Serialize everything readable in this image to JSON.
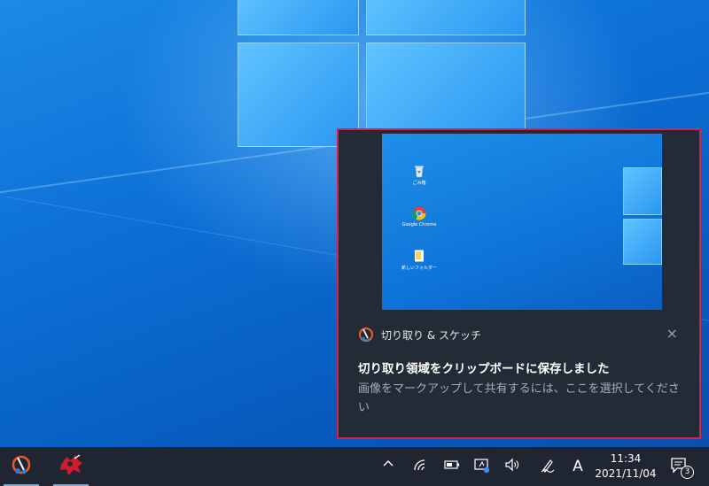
{
  "desktop": {
    "wallpaper": "Windows 10 default"
  },
  "toast": {
    "app_name": "切り取り & スケッチ",
    "close_glyph": "×",
    "title": "切り取り領域をクリップボードに保存しました",
    "body": "画像をマークアップして共有するには、ここを選択してください",
    "preview": {
      "icons": [
        {
          "name": "recycle-bin",
          "label": "ごみ箱"
        },
        {
          "name": "google-chrome",
          "label": "Google Chrome"
        },
        {
          "name": "folder-shortcut",
          "label": "新しいフォルダー"
        }
      ]
    },
    "border_color": "#d4234e"
  },
  "taskbar": {
    "apps": [
      {
        "name": "snip-and-sketch",
        "active": true
      },
      {
        "name": "paint-app",
        "active": true
      }
    ],
    "tray": {
      "chevron": "^",
      "ime_mode": "A",
      "time": "11:34",
      "date": "2021/11/04",
      "notification_count": "3"
    }
  }
}
